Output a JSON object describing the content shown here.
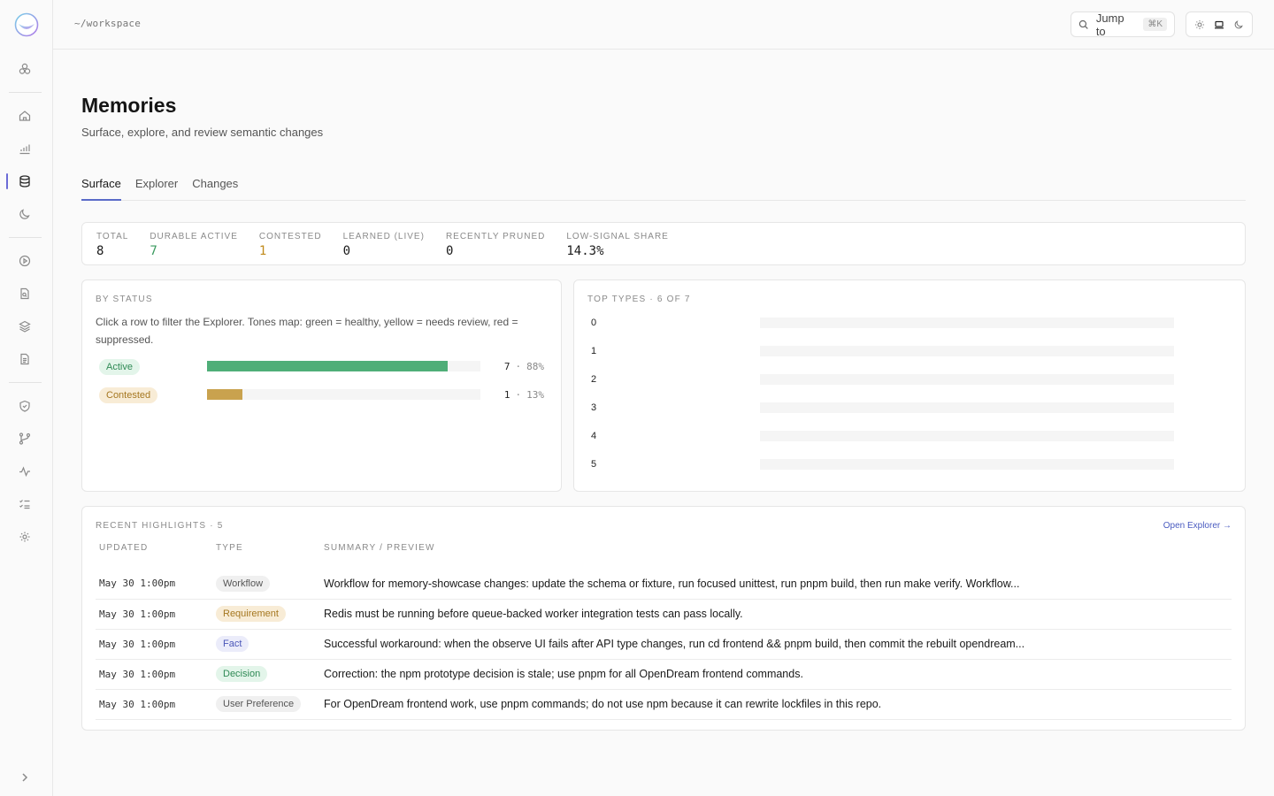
{
  "breadcrumb": "~/workspace",
  "jump": {
    "label": "Jump to",
    "shortcut": "⌘K"
  },
  "page": {
    "title": "Memories",
    "subtitle": "Surface, explore, and review semantic changes"
  },
  "tabs": [
    {
      "label": "Surface",
      "active": true
    },
    {
      "label": "Explorer",
      "active": false
    },
    {
      "label": "Changes",
      "active": false
    }
  ],
  "stats": [
    {
      "label": "TOTAL",
      "value": "8",
      "color": "#1a1a1a"
    },
    {
      "label": "DURABLE ACTIVE",
      "value": "7",
      "color": "#3a9a5f"
    },
    {
      "label": "CONTESTED",
      "value": "1",
      "color": "#c08a1a"
    },
    {
      "label": "LEARNED (LIVE)",
      "value": "0",
      "color": "#1a1a1a"
    },
    {
      "label": "RECENTLY PRUNED",
      "value": "0",
      "color": "#1a1a1a"
    },
    {
      "label": "LOW-SIGNAL SHARE",
      "value": "14.3%",
      "color": "#1a1a1a"
    }
  ],
  "by_status": {
    "label": "BY STATUS",
    "description": "Click a row to filter the Explorer. Tones map: green = healthy, yellow = needs review, red = suppressed.",
    "rows": [
      {
        "name": "Active",
        "count": "7",
        "sep": "·",
        "pct": "88%",
        "fraction": 0.88,
        "color": "#4fae78",
        "pill_bg": "#e3f5ea",
        "pill_fg": "#2f8a55"
      },
      {
        "name": "Contested",
        "count": "1",
        "sep": "·",
        "pct": "13%",
        "fraction": 0.13,
        "color": "#c9a24e",
        "pill_bg": "#f8ecd6",
        "pill_fg": "#a57720"
      }
    ]
  },
  "top_types": {
    "label": "TOP TYPES · 6 OF 7",
    "rows": [
      "0",
      "1",
      "2",
      "3",
      "4",
      "5"
    ]
  },
  "highlights": {
    "label": "RECENT HIGHLIGHTS · 5",
    "open_link": "Open Explorer →",
    "columns": [
      "UPDATED",
      "TYPE",
      "SUMMARY / PREVIEW"
    ],
    "rows": [
      {
        "updated": "May 30 1:00pm",
        "type": "Workflow",
        "type_bg": "#f0f0f0",
        "type_fg": "#555555",
        "summary": "Workflow for memory-showcase changes: update the schema or fixture, run focused unittest, run pnpm build, then run make verify. Workflow..."
      },
      {
        "updated": "May 30 1:00pm",
        "type": "Requirement",
        "type_bg": "#f8ecd6",
        "type_fg": "#a57720",
        "summary": "Redis must be running before queue-backed worker integration tests can pass locally."
      },
      {
        "updated": "May 30 1:00pm",
        "type": "Fact",
        "type_bg": "#ebecfa",
        "type_fg": "#4a56b8",
        "summary": "Successful workaround: when the observe UI fails after API type changes, run cd frontend && pnpm build, then commit the rebuilt opendream..."
      },
      {
        "updated": "May 30 1:00pm",
        "type": "Decision",
        "type_bg": "#e3f5ea",
        "type_fg": "#2f8a55",
        "summary": "Correction: the npm prototype decision is stale; use pnpm for all OpenDream frontend commands."
      },
      {
        "updated": "May 30 1:00pm",
        "type": "User Preference",
        "type_bg": "#f0f0f0",
        "type_fg": "#555555",
        "summary": "For OpenDream frontend work, use pnpm commands; do not use npm because it can rewrite lockfiles in this repo."
      }
    ]
  }
}
